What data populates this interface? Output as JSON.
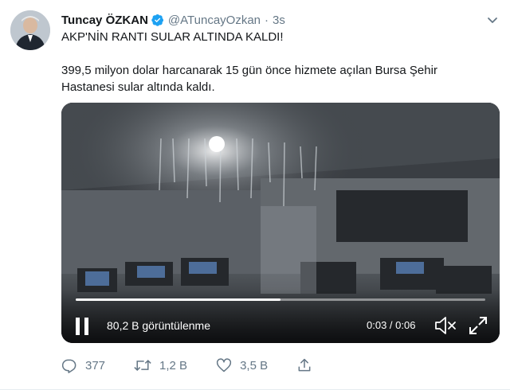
{
  "tweet": {
    "author_name": "Tuncay ÖZKAN",
    "handle": "@ATuncayOzkan",
    "separator": "·",
    "time": "3s",
    "line1": "AKP'NİN RANTI SULAR ALTINDA KALDI!",
    "body": "399,5 milyon dolar harcanarak 15 gün önce hizmete açılan Bursa Şehir Hastanesi sular altında kaldı."
  },
  "video": {
    "views": "80,2 B görüntülenme",
    "time": "0:03 / 0:06",
    "progress": 0.5
  },
  "actions": {
    "replies": "377",
    "retweets": "1,2 B",
    "likes": "3,5 B"
  },
  "icons": {
    "verified": "verified-badge-icon",
    "chevron": "chevron-down-icon",
    "reply": "reply-icon",
    "retweet": "retweet-icon",
    "like": "heart-icon",
    "share": "share-icon",
    "pause": "pause-icon",
    "mute": "mute-icon",
    "fullscreen": "fullscreen-icon"
  },
  "colors": {
    "verified": "#1da1f2",
    "secondary_text": "#657786",
    "primary_text": "#14171a"
  }
}
